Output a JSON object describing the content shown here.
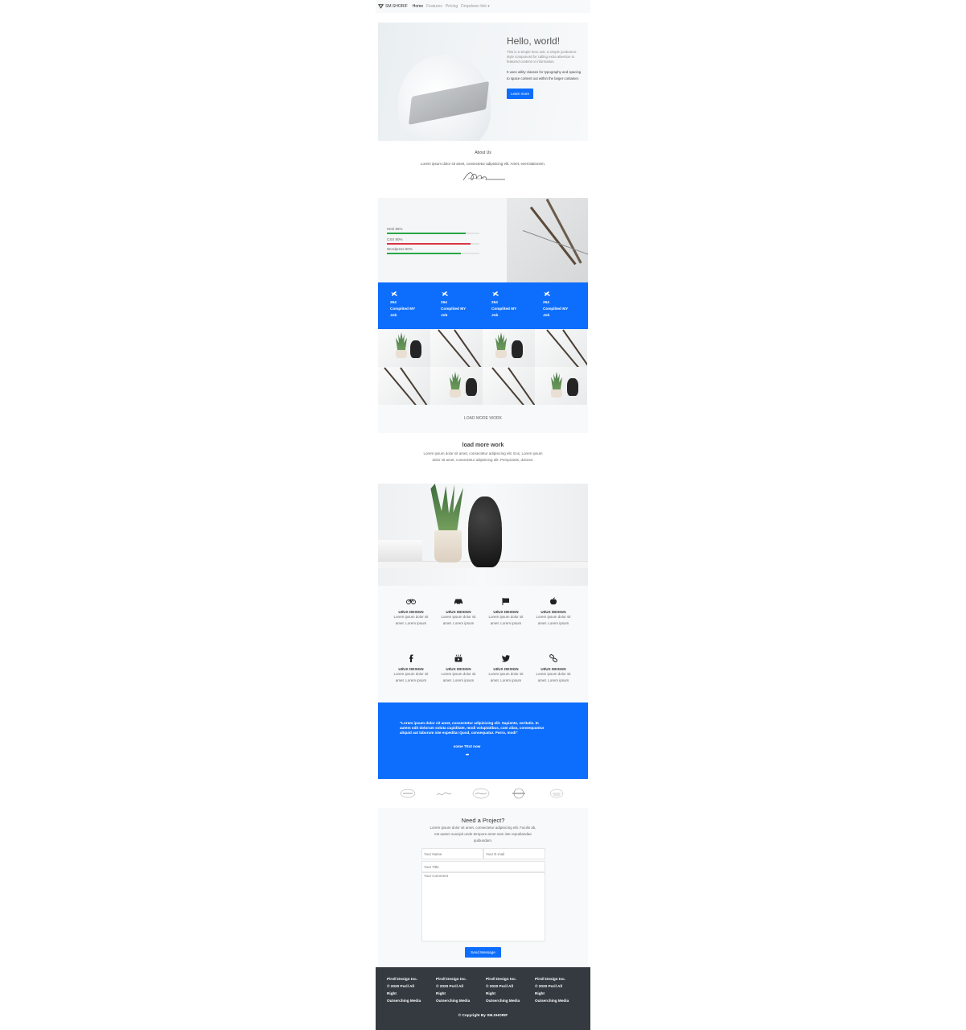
{
  "navbar": {
    "brand": "SM.SHORIF",
    "links": [
      {
        "label": "Home",
        "active": true
      },
      {
        "label": "Features",
        "active": false
      },
      {
        "label": "Pricing",
        "active": false
      },
      {
        "label": "Dropdown link ▾",
        "active": false
      }
    ]
  },
  "hero": {
    "title": "Hello, world!",
    "lead": "This is a simple hero unit, a simple jumbotron-style component for calling extra attention to featured content or information.",
    "paragraph": "It uses utility classes for typography and spacing to space content out within the larger container.",
    "button_label": "Learn more"
  },
  "about": {
    "title": "About Us",
    "text": "Lorem ipsum dolor sit amet, consectetur adipisicing elit. Amet, exercitationem."
  },
  "skills": [
    {
      "label": "Html 85%",
      "percent": 85,
      "color": "#28a745"
    },
    {
      "label": "CSS 90%",
      "percent": 90,
      "color": "#dc3545"
    },
    {
      "label": "Wordpress 80%",
      "percent": 80,
      "color": "#28a745"
    }
  ],
  "stats": [
    {
      "number": "254",
      "line1": "Complited MY",
      "line2": "Job"
    },
    {
      "number": "254",
      "line1": "Complited MY",
      "line2": "Job"
    },
    {
      "number": "254",
      "line1": "Complited MY",
      "line2": "Job"
    },
    {
      "number": "254",
      "line1": "Complited MY",
      "line2": "Job"
    }
  ],
  "gallery": {
    "load_more_label": "LOAD MORE WORK"
  },
  "load_more_section": {
    "title": "load more work",
    "text": "Lorem ipsum dolor sit amet, consectetur adipisicing elit. Eos, Lorem ipsum dolor sit amet, consectetur adipisicing elit. Perspiciatis, dolores."
  },
  "services": [
    {
      "icon": "bicycle-icon",
      "title": "UI/UX DESIGN",
      "text": "Lorem ipsum dolor sit amet. Lorem ipsum"
    },
    {
      "icon": "car-icon",
      "title": "UI/UX DESIGN",
      "text": "Lorem ipsum dolor sit amet. Lorem ipsum"
    },
    {
      "icon": "flag-icon",
      "title": "UI/UX DESIGN",
      "text": "Lorem ipsum dolor sit amet. Lorem ipsum"
    },
    {
      "icon": "apple-icon",
      "title": "UI/UX DESIGN",
      "text": "Lorem ipsum dolor sit amet. Lorem ipsum"
    },
    {
      "icon": "facebook-icon",
      "title": "UI/UX DESIGN",
      "text": "Lorem ipsum dolor sit amet. Lorem ipsum"
    },
    {
      "icon": "youtube-icon",
      "title": "UI/UX DESIGN",
      "text": "Lorem ipsum dolor sit amet. Lorem ipsum"
    },
    {
      "icon": "twitter-icon",
      "title": "UI/UX DESIGN",
      "text": "Lorem ipsum dolor sit amet. Lorem ipsum"
    },
    {
      "icon": "link-icon",
      "title": "UI/UX DESIGN",
      "text": "Lorem ipsum dolor sit amet. Lorem ipsum"
    }
  ],
  "testimonial": {
    "quote": "\"Lorem ipsum dolor sit amet, consectetur adipisicing elit. Sapiente, veritatis. In autem odit dolorum soluta cupiditate, modi voluptatibus, cum alias, consequuntur aliquid aut laborum iste expedita! Quod, consequatur. Porro, modi\"",
    "author": "some TExt now",
    "dots": "•••"
  },
  "contact": {
    "title": "Need a Project?",
    "text": "Lorem ipsum dolor sit amet, consectetur adipisicing elit. Facilis ab, est autem suscipit unde tempore amet nam iste repudiandae quibusdam.",
    "name_placeholder": "Your Name",
    "email_placeholder": "Your E-mail",
    "title_placeholder": "Your Title",
    "comment_placeholder": "Your Comment",
    "send_label": "Send Message"
  },
  "footer": {
    "columns": [
      {
        "line1": "Piroll Design Inc.",
        "line2": "© 2020 Poril All",
        "line3": "Right",
        "line4": "Outserching Media"
      },
      {
        "line1": "Piroll Design Inc.",
        "line2": "© 2020 Poril All",
        "line3": "Right",
        "line4": "Outserching Media"
      },
      {
        "line1": "Piroll Design Inc.",
        "line2": "© 2020 Poril All",
        "line3": "Right",
        "line4": "Outserching Media"
      },
      {
        "line1": "Piroll Design Inc.",
        "line2": "© 2020 Poril All",
        "line3": "Right",
        "line4": "Outserching Media"
      }
    ],
    "copyright": "© Copyright By SM.SHORIF"
  },
  "colors": {
    "primary": "#0d6efd",
    "footer_bg": "#343a40",
    "light_bg": "#f8f9fa"
  }
}
